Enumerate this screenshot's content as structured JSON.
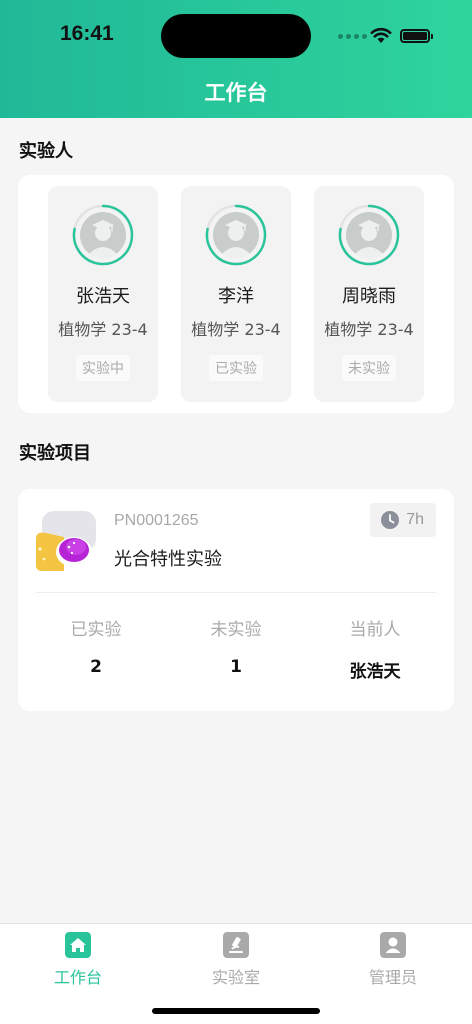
{
  "status_bar": {
    "time": "16:41"
  },
  "header": {
    "title": "工作台"
  },
  "experimenters": {
    "section_title": "实验人",
    "people": [
      {
        "name": "张浩天",
        "class": "植物学 23-4",
        "status": "实验中"
      },
      {
        "name": "李洋",
        "class": "植物学 23-4",
        "status": "已实验"
      },
      {
        "name": "周晓雨",
        "class": "植物学 23-4",
        "status": "未实验"
      }
    ]
  },
  "projects": {
    "section_title": "实验项目",
    "items": [
      {
        "code": "PN0001265",
        "name": "光合特性实验",
        "duration": "7h",
        "stats": [
          {
            "label": "已实验",
            "value": "2"
          },
          {
            "label": "未实验",
            "value": "1"
          },
          {
            "label": "当前人",
            "value": "张浩天"
          }
        ]
      }
    ]
  },
  "tabbar": {
    "tabs": [
      {
        "label": "工作台",
        "icon": "home-icon",
        "active": true
      },
      {
        "label": "实验室",
        "icon": "microscope-icon",
        "active": false
      },
      {
        "label": "管理员",
        "icon": "user-icon",
        "active": false
      }
    ]
  },
  "colors": {
    "accent": "#2ac49b",
    "header_gradient_start": "#20b998",
    "header_gradient_end": "#2fd49c",
    "tab_inactive": "#a9a9a9"
  }
}
